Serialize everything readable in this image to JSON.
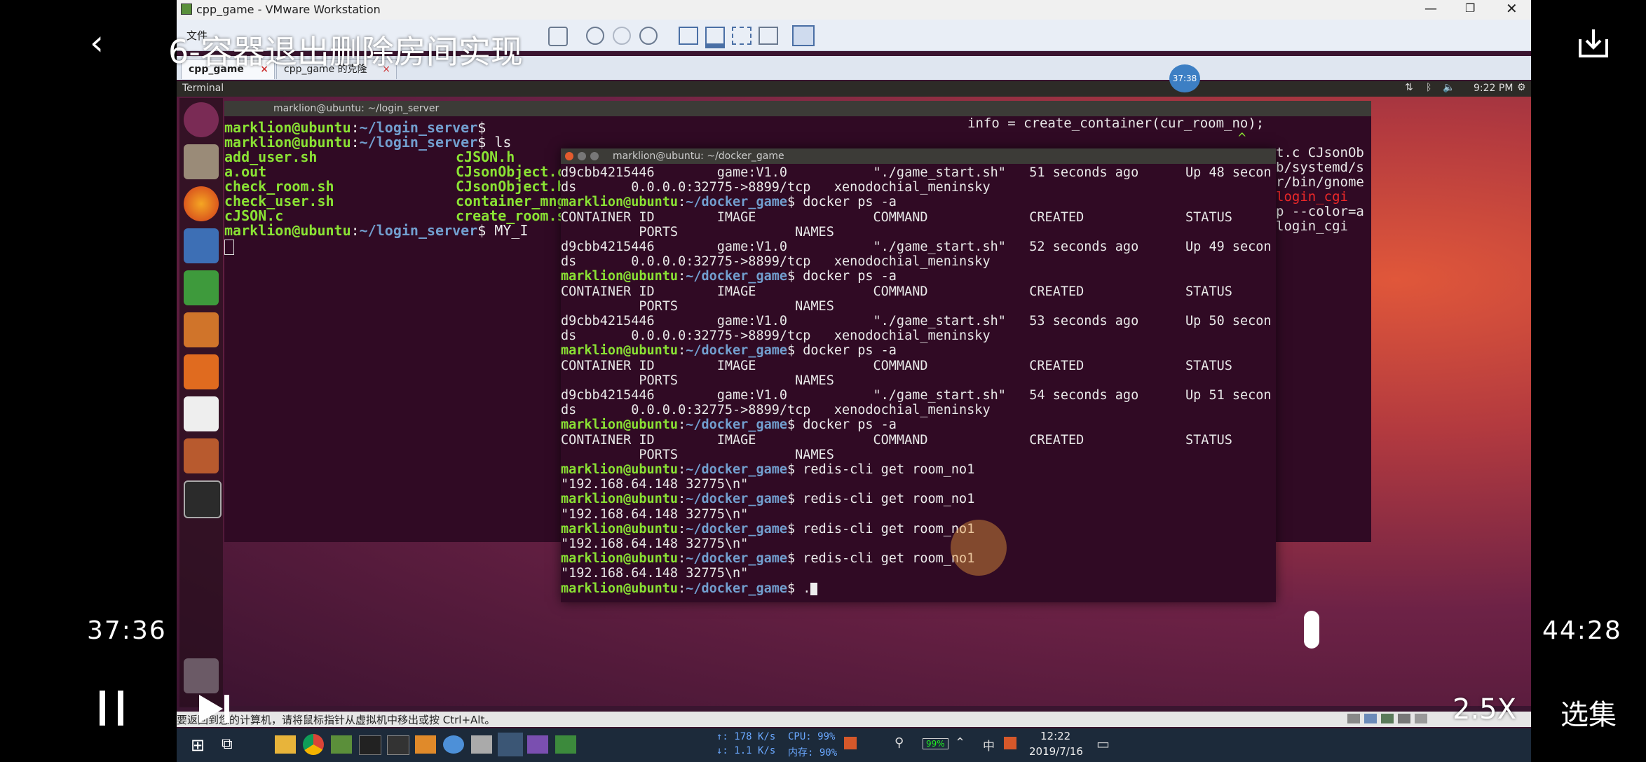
{
  "player": {
    "title": "6-容器退出删除房间实现",
    "current_time": "37:36",
    "total_time": "44:28",
    "speed": "2.5X",
    "episodes": "选集",
    "progress": 0.846
  },
  "vmware": {
    "window_title": "cpp_game - VMware Workstation",
    "menu_file": "文件",
    "tabs": [
      "cpp_game",
      "cpp_game 的克隆"
    ],
    "status_hint": "要返回到您的计算机，请将鼠标指针从虚拟机中移出或按 Ctrl+Alt。",
    "clock_badge": "37:38"
  },
  "ubuntu": {
    "topbar_app": "Terminal",
    "clock": "9:22 PM"
  },
  "term_back": {
    "title": "marklion@ubuntu: ~/login_server",
    "prompt_user": "marklion@ubuntu",
    "prompt_path": "~/login_server",
    "lines": [
      {
        "type": "prompt",
        "cmd": ""
      },
      {
        "type": "prompt",
        "cmd": " ls"
      },
      {
        "type": "files",
        "a": "add_user.sh",
        "b": "cJSON.h"
      },
      {
        "type": "files",
        "a": "a.out",
        "b": "CJsonObject.cpp"
      },
      {
        "type": "files",
        "a": "check_room.sh",
        "b": "CJsonObject.hpp"
      },
      {
        "type": "files",
        "a": "check_user.sh",
        "b": "container_mnger.out"
      },
      {
        "type": "files",
        "a": "cJSON.c",
        "b": "create_room.sh"
      },
      {
        "type": "prompt",
        "cmd": " MY_I"
      }
    ]
  },
  "term_right": {
    "lines": [
      "info = create_container(cur_room_no);",
      "^",
      "",
      "",
      "",
      "t.c CJsonOb",
      "",
      "b/systemd/s",
      "",
      "r/bin/gnome",
      "",
      "login_cgi",
      "p --color=a",
      "",
      "",
      "login_cgi"
    ]
  },
  "term_front": {
    "title": "marklion@ubuntu: ~/docker_game",
    "prompt_user": "marklion@ubuntu",
    "prompt_path": "~/docker_game",
    "lines": [
      {
        "t": "o",
        "s": "d9cbb4215446        game:V1.0           \"./game_start.sh\"   51 seconds ago      Up 48 secon"
      },
      {
        "t": "o",
        "s": "ds       0.0.0.0:32775->8899/tcp   xenodochial_meninsky"
      },
      {
        "t": "p",
        "s": " docker ps -a"
      },
      {
        "t": "o",
        "s": "CONTAINER ID        IMAGE               COMMAND             CREATED             STATUS"
      },
      {
        "t": "o",
        "s": "          PORTS               NAMES"
      },
      {
        "t": "o",
        "s": "d9cbb4215446        game:V1.0           \"./game_start.sh\"   52 seconds ago      Up 49 secon"
      },
      {
        "t": "o",
        "s": "ds       0.0.0.0:32775->8899/tcp   xenodochial_meninsky"
      },
      {
        "t": "p",
        "s": " docker ps -a"
      },
      {
        "t": "o",
        "s": "CONTAINER ID        IMAGE               COMMAND             CREATED             STATUS"
      },
      {
        "t": "o",
        "s": "          PORTS               NAMES"
      },
      {
        "t": "o",
        "s": "d9cbb4215446        game:V1.0           \"./game_start.sh\"   53 seconds ago      Up 50 secon"
      },
      {
        "t": "o",
        "s": "ds       0.0.0.0:32775->8899/tcp   xenodochial_meninsky"
      },
      {
        "t": "p",
        "s": " docker ps -a"
      },
      {
        "t": "o",
        "s": "CONTAINER ID        IMAGE               COMMAND             CREATED             STATUS"
      },
      {
        "t": "o",
        "s": "          PORTS               NAMES"
      },
      {
        "t": "o",
        "s": "d9cbb4215446        game:V1.0           \"./game_start.sh\"   54 seconds ago      Up 51 secon"
      },
      {
        "t": "o",
        "s": "ds       0.0.0.0:32775->8899/tcp   xenodochial_meninsky"
      },
      {
        "t": "p",
        "s": " docker ps -a"
      },
      {
        "t": "o",
        "s": "CONTAINER ID        IMAGE               COMMAND             CREATED             STATUS"
      },
      {
        "t": "o",
        "s": "          PORTS               NAMES"
      },
      {
        "t": "p",
        "s": " redis-cli get room_no1"
      },
      {
        "t": "o",
        "s": "\"192.168.64.148 32775\\n\""
      },
      {
        "t": "p",
        "s": " redis-cli get room_no1"
      },
      {
        "t": "o",
        "s": "\"192.168.64.148 32775\\n\""
      },
      {
        "t": "p",
        "s": " redis-cli get room_no1"
      },
      {
        "t": "o",
        "s": "\"192.168.64.148 32775\\n\""
      },
      {
        "t": "p",
        "s": " redis-cli get room_no1"
      },
      {
        "t": "o",
        "s": "\"192.168.64.148 32775\\n\""
      },
      {
        "t": "p",
        "s": " ."
      }
    ]
  },
  "taskbar": {
    "net_up": "↑: 178 K/s",
    "net_down": "↓: 1.1 K/s",
    "cpu": "CPU: 99%",
    "mem": "内存: 90%",
    "battery": "99%",
    "ime": "中",
    "time": "12:22",
    "date": "2019/7/16"
  }
}
